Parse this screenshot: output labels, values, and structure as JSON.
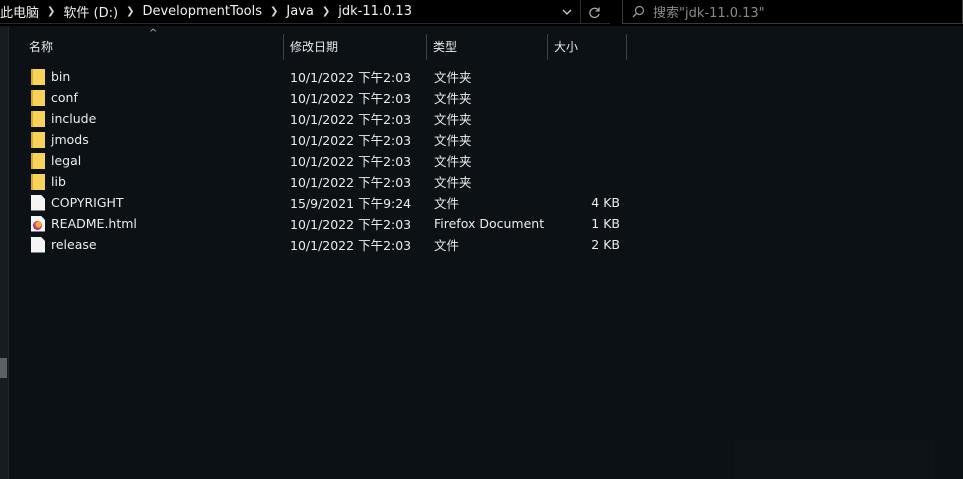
{
  "breadcrumb": {
    "items": [
      "此电脑",
      "软件 (D:)",
      "DevelopmentTools",
      "Java",
      "jdk-11.0.13"
    ]
  },
  "search": {
    "placeholder": "搜索\"jdk-11.0.13\""
  },
  "columns": {
    "name": "名称",
    "date": "修改日期",
    "type": "类型",
    "size": "大小"
  },
  "files": [
    {
      "name": "bin",
      "date": "10/1/2022 下午2:03",
      "type": "文件夹",
      "size": "",
      "icon": "folder-icon"
    },
    {
      "name": "conf",
      "date": "10/1/2022 下午2:03",
      "type": "文件夹",
      "size": "",
      "icon": "folder-icon"
    },
    {
      "name": "include",
      "date": "10/1/2022 下午2:03",
      "type": "文件夹",
      "size": "",
      "icon": "folder-icon"
    },
    {
      "name": "jmods",
      "date": "10/1/2022 下午2:03",
      "type": "文件夹",
      "size": "",
      "icon": "folder-icon"
    },
    {
      "name": "legal",
      "date": "10/1/2022 下午2:03",
      "type": "文件夹",
      "size": "",
      "icon": "folder-icon"
    },
    {
      "name": "lib",
      "date": "10/1/2022 下午2:03",
      "type": "文件夹",
      "size": "",
      "icon": "folder-icon"
    },
    {
      "name": "COPYRIGHT",
      "date": "15/9/2021 下午9:24",
      "type": "文件",
      "size": "4 KB",
      "icon": "file-icon"
    },
    {
      "name": "README.html",
      "date": "10/1/2022 下午2:03",
      "type": "Firefox Document",
      "size": "1 KB",
      "icon": "firefox-document-icon"
    },
    {
      "name": "release",
      "date": "10/1/2022 下午2:03",
      "type": "文件",
      "size": "2 KB",
      "icon": "file-icon"
    }
  ],
  "colors": {
    "background": "#0c1116",
    "folder": "#f7d35c",
    "text": "#ececec"
  }
}
